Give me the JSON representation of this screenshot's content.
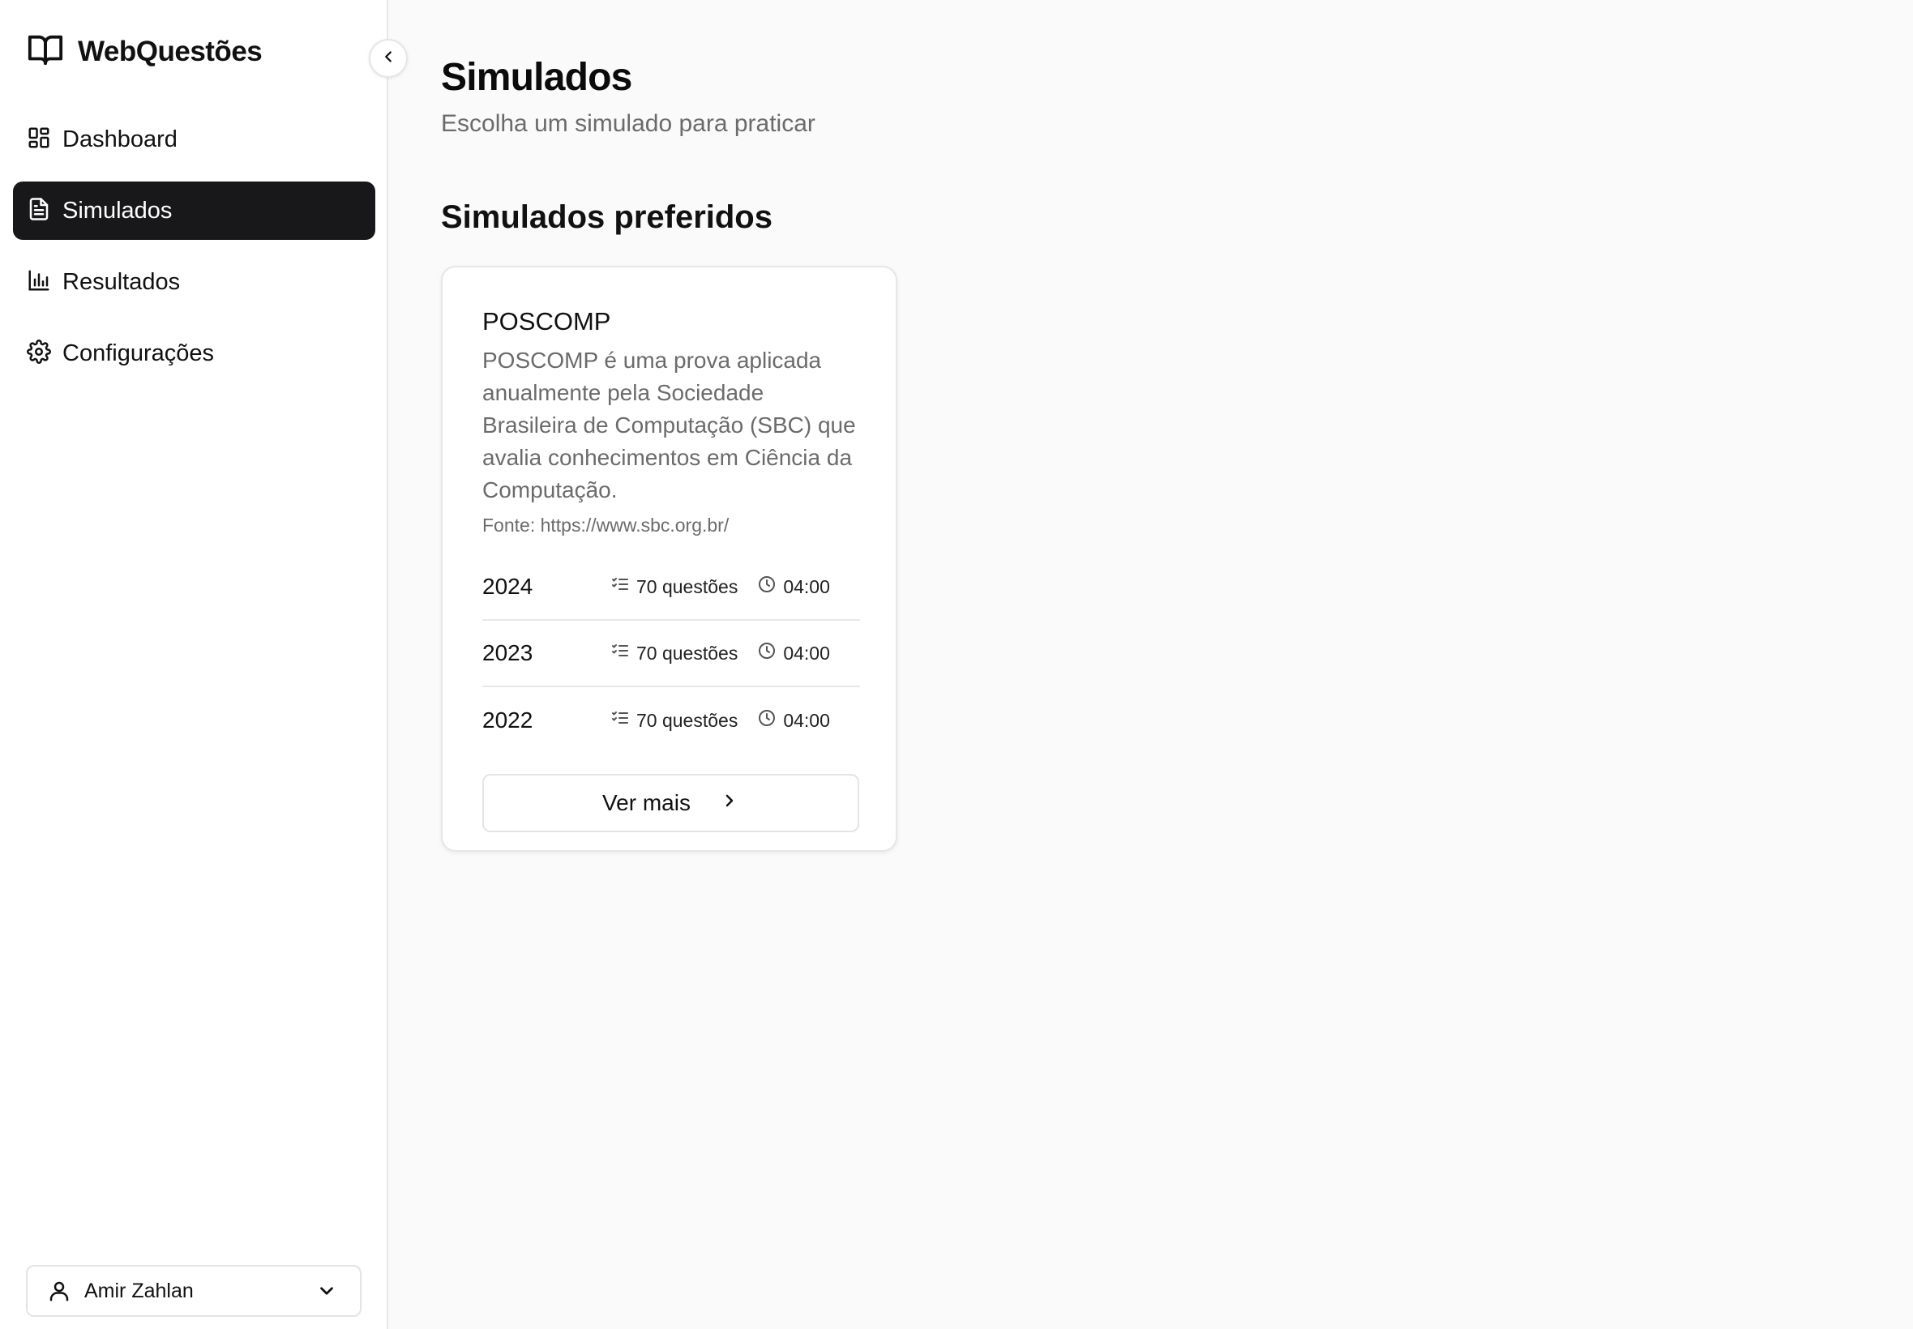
{
  "brand": {
    "name": "WebQuestões",
    "icon": "book-open-icon"
  },
  "sidebar": {
    "collapse_icon": "chevron-left-icon",
    "items": [
      {
        "label": "Dashboard",
        "icon": "layout-dashboard-icon",
        "active": false
      },
      {
        "label": "Simulados",
        "icon": "file-text-icon",
        "active": true
      },
      {
        "label": "Resultados",
        "icon": "bar-chart-icon",
        "active": false
      },
      {
        "label": "Configurações",
        "icon": "settings-icon",
        "active": false
      }
    ],
    "user": {
      "name": "Amir Zahlan",
      "icon": "user-icon",
      "dropdown_icon": "chevron-down-icon"
    }
  },
  "main": {
    "title": "Simulados",
    "subtitle": "Escolha um simulado para praticar",
    "section_title": "Simulados preferidos",
    "card": {
      "title": "POSCOMP",
      "description": "POSCOMP é uma prova aplicada anualmente pela Sociedade Brasileira de Computação (SBC) que avalia conhecimentos em Ciência da Computação.",
      "source": "Fonte: https://www.sbc.org.br/",
      "years": [
        {
          "year": "2024",
          "questions": "70 questões",
          "time": "04:00"
        },
        {
          "year": "2023",
          "questions": "70 questões",
          "time": "04:00"
        },
        {
          "year": "2022",
          "questions": "70 questões",
          "time": "04:00"
        }
      ],
      "button_label": "Ver mais"
    }
  },
  "colors": {
    "active_bg": "#18181b",
    "muted_text": "#6b6b6b",
    "page_bg": "#fafafa"
  }
}
